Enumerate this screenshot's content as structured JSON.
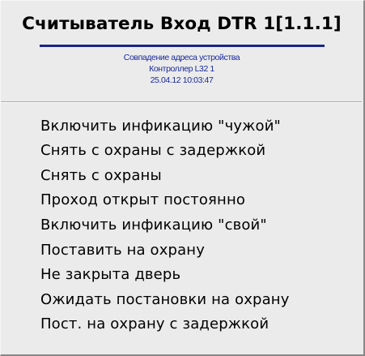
{
  "menu": {
    "header": {
      "title": "Считыватель Вход DTR 1[1.1.1]",
      "accent_color": "#1b2583",
      "detail_color": "#1a2a9c",
      "lines": [
        "Совпадение адреса устройства",
        "Контроллер L32 1",
        "25.04.12 10:03:47"
      ]
    },
    "items": [
      {
        "label": "Включить инфикацию \"чужой\""
      },
      {
        "label": "Снять с охраны с задержкой"
      },
      {
        "label": "Снять с охраны"
      },
      {
        "label": "Проход открыт постоянно"
      },
      {
        "label": "Включить инфикацию \"свой\""
      },
      {
        "label": "Поставить на охрану"
      },
      {
        "label": "Не закрыта дверь"
      },
      {
        "label": "Ожидать постановки на охрану"
      },
      {
        "label": "Пост. на охрану с задержкой"
      }
    ]
  }
}
